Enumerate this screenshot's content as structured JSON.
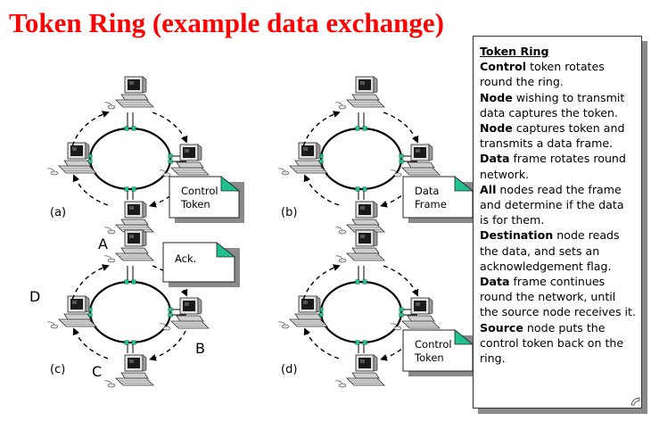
{
  "title": "Token Ring (example data exchange)",
  "colors": {
    "title": "#ff0000",
    "connector": "#20c090",
    "note_corner": "#20c090",
    "ring": "#000000",
    "shadow": "#8a8a8a"
  },
  "diagrams": [
    {
      "id": "a",
      "label": "(a)",
      "note": {
        "lines": [
          "Control",
          "Token"
        ]
      }
    },
    {
      "id": "b",
      "label": "(b)",
      "note": {
        "lines": [
          "Data",
          "Frame"
        ]
      }
    },
    {
      "id": "c",
      "label": "(c)",
      "note": {
        "lines": [
          "Ack."
        ]
      },
      "node_labels": {
        "top": "A",
        "right": "B",
        "bottom": "C",
        "left": "D"
      }
    },
    {
      "id": "d",
      "label": "(d)",
      "note": {
        "lines": [
          "Control",
          "Token"
        ]
      }
    }
  ],
  "icons": {
    "node": "desktop-computer-icon",
    "direction": "dashed-arrow-clockwise"
  },
  "panel": {
    "heading": "Token Ring",
    "items": [
      {
        "bold": "Control",
        "text": " token rotates round the ring."
      },
      {
        "bold": "Node",
        "text": " wishing to transmit data captures the token."
      },
      {
        "bold": "Node",
        "text": " captures token and transmits a data frame."
      },
      {
        "bold": "Data",
        "text": " frame rotates round network."
      },
      {
        "bold": "All",
        "text": " nodes read the frame and determine if the data is for them."
      },
      {
        "bold": "Destination",
        "text": " node reads the data, and sets an acknowledgement flag."
      },
      {
        "bold": "Data",
        "text": " frame continues round the network, until the source node receives it."
      },
      {
        "bold": "Source",
        "text": " node puts the control token back on the ring."
      }
    ]
  }
}
